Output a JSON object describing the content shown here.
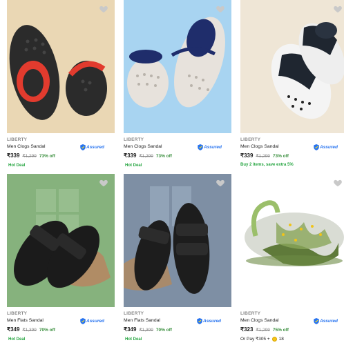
{
  "products": [
    {
      "brand": "LIBERTY",
      "name": "Men Clogs Sandal",
      "assured": "Assured",
      "price": "₹339",
      "mrp": "₹1,299",
      "discount": "73% off",
      "tag": "Hot Deal",
      "bg": "#ead7b4",
      "shoe_color": "#2b2b2b",
      "strap_color": "#e23b2e",
      "wishlist_icon": "heart-icon"
    },
    {
      "brand": "LIBERTY",
      "name": "Men Clogs Sandal",
      "assured": "Assured",
      "price": "₹339",
      "mrp": "₹1,299",
      "discount": "73% off",
      "tag": "Hot Deal",
      "bg": "#a8d4f1",
      "shoe_color": "#e7e2dc",
      "strap_color": "#1f2d6b",
      "wishlist_icon": "heart-icon"
    },
    {
      "brand": "LIBERTY",
      "name": "Men Clogs Sandal",
      "assured": "Assured",
      "price": "₹339",
      "mrp": "₹1,299",
      "discount": "73% off",
      "offer": "Buy 2 items, save extra 5%",
      "bg": "#efe6d6",
      "shoe_color": "#1f2630",
      "strap_color": "#2a3340",
      "wishlist_icon": "heart-icon"
    },
    {
      "brand": "LIBERTY",
      "name": "Men Flats Sandal",
      "assured": "Assured",
      "price": "₹349",
      "mrp": "₹1,399",
      "discount": "70% off",
      "tag": "Hot Deal",
      "bg": "#86b27d",
      "shoe_color": "#1b1b1b",
      "strap_color": "#1b1b1b",
      "wishlist_icon": "heart-icon"
    },
    {
      "brand": "LIBERTY",
      "name": "Men Flats Sandal",
      "assured": "Assured",
      "price": "₹349",
      "mrp": "₹1,399",
      "discount": "70% off",
      "tag": "Hot Deal",
      "bg": "#7e8fa4",
      "shoe_color": "#1d1d1d",
      "strap_color": "#1d1d1d",
      "wishlist_icon": "heart-icon"
    },
    {
      "brand": "LIBERTY",
      "name": "Men Clogs Sandal",
      "assured": "Assured",
      "price": "₹323",
      "mrp": "₹1,299",
      "discount": "75% off",
      "supercoin_prefix": "Or Pay ₹305 +",
      "supercoin_count": "18",
      "bg": "#ffffff",
      "shoe_color": "#d9dcd4",
      "strap_color": "#9bbf6a",
      "wishlist_icon": "heart-icon"
    }
  ],
  "colors": {
    "price": "#212121",
    "mrp": "#878787",
    "discount": "#388e3c",
    "deal": "#26a541",
    "assured": "#2874f0"
  }
}
